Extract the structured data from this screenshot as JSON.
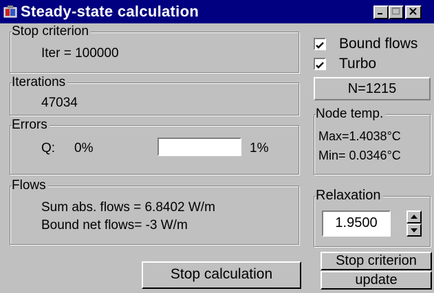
{
  "window": {
    "title": "Steady-state calculation",
    "controls": {
      "minimize": "_",
      "maximize": "□",
      "close": "×"
    },
    "title_bar_color": "#000080",
    "face_color": "#c0c0c0"
  },
  "stop_criterion": {
    "label": "Stop criterion",
    "value": "Iter = 100000"
  },
  "iterations": {
    "label": "Iterations",
    "value": "47034"
  },
  "errors": {
    "label": "Errors",
    "q_label": "Q:",
    "q_value": "0%",
    "target": "1%",
    "progress_fraction": 0.0
  },
  "flows": {
    "label": "Flows",
    "sum_abs": "Sum abs. flows = 6.8402 W/m",
    "bound_net": "Bound net flows= -3 W/m"
  },
  "options": {
    "bound_flows": {
      "label": "Bound flows",
      "checked": true
    },
    "turbo": {
      "label": "Turbo",
      "checked": true
    }
  },
  "node_count": "N=1215",
  "node_temp": {
    "label": "Node temp.",
    "max": "Max=1.4038°C",
    "min": "Min= 0.0346°C"
  },
  "relaxation": {
    "label": "Relaxation",
    "value": "1.9500"
  },
  "buttons": {
    "stop_calculation": "Stop calculation",
    "stop_criterion_update_line1": "Stop criterion",
    "stop_criterion_update_line2": "update"
  }
}
